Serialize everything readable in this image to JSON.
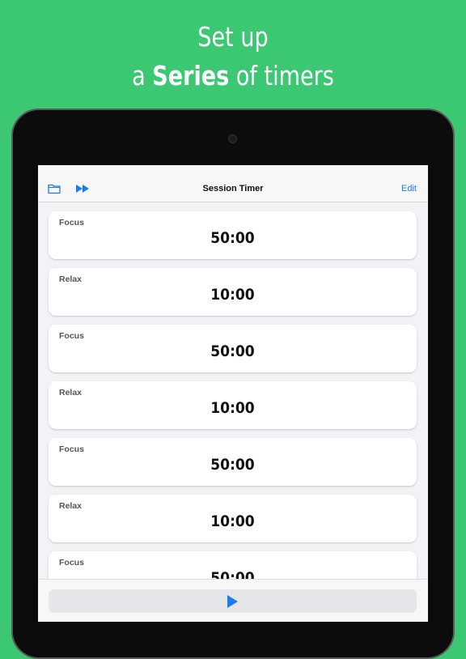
{
  "headline": {
    "line1": "Set up",
    "line2_prefix": "a ",
    "line2_bold": "Series",
    "line2_suffix": " of timers"
  },
  "navbar": {
    "title": "Session Timer",
    "edit_label": "Edit",
    "folder_icon": "folder-icon",
    "fast_forward_icon": "fast-forward-icon"
  },
  "timers": [
    {
      "label": "Focus",
      "time": "50:00"
    },
    {
      "label": "Relax",
      "time": "10:00"
    },
    {
      "label": "Focus",
      "time": "50:00"
    },
    {
      "label": "Relax",
      "time": "10:00"
    },
    {
      "label": "Focus",
      "time": "50:00"
    },
    {
      "label": "Relax",
      "time": "10:00"
    },
    {
      "label": "Focus",
      "time": "50:00"
    }
  ],
  "bottom": {
    "play_icon": "play-icon"
  },
  "colors": {
    "background": "#3cc872",
    "accent": "#1a7cf2"
  }
}
